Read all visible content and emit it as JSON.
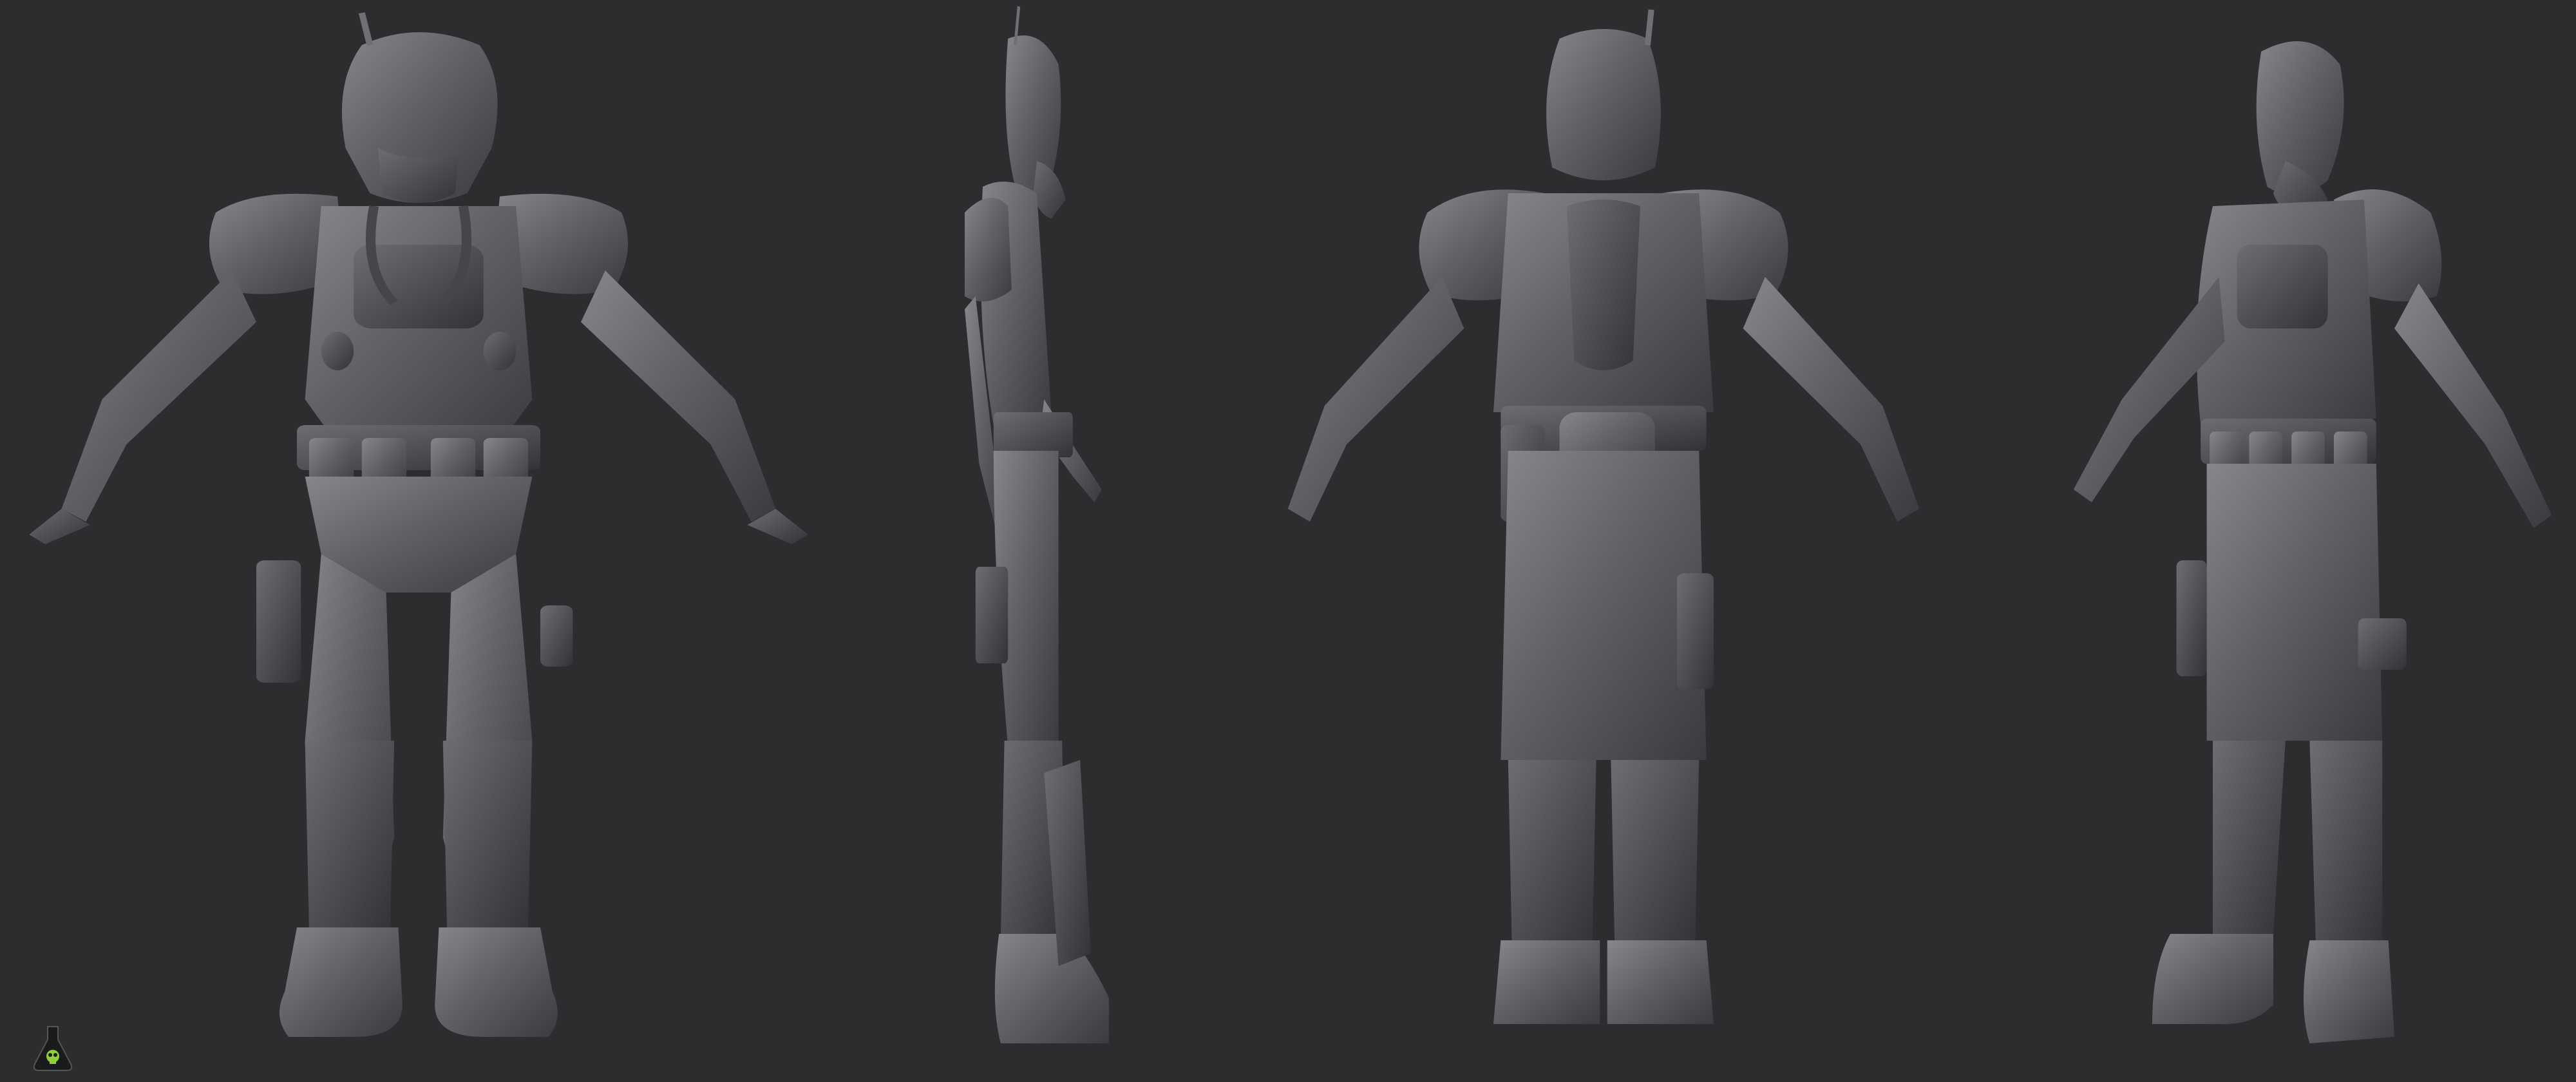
{
  "scene": {
    "background_color": "#2d2d2f",
    "clay_color": "#5e5f62",
    "clay_highlight": "#86878a",
    "clay_shadow": "#3a3b3e"
  },
  "views": [
    {
      "id": "front",
      "angle": "front"
    },
    {
      "id": "side",
      "angle": "side"
    },
    {
      "id": "back",
      "angle": "back"
    },
    {
      "id": "three-quarter",
      "angle": "three-quarter"
    }
  ],
  "logo": {
    "icon": "flask-skull-icon",
    "color": "#8fcf3a"
  }
}
